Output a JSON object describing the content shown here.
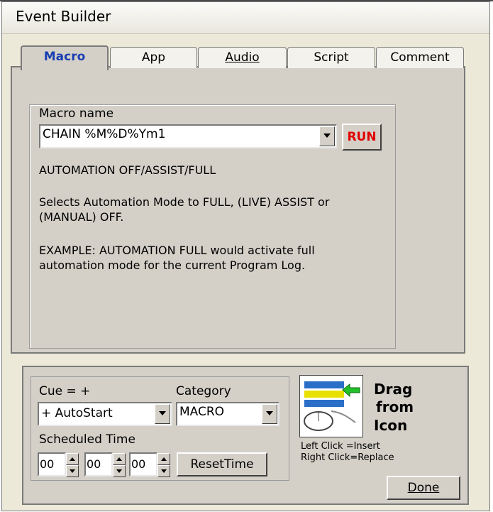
{
  "window": {
    "title": "Event Builder"
  },
  "tabs": [
    {
      "label": "Macro",
      "active": true
    },
    {
      "label": "App"
    },
    {
      "label": "Audio"
    },
    {
      "label": "Script"
    },
    {
      "label": "Comment"
    }
  ],
  "macro": {
    "name_label": "Macro name",
    "name_value": "CHAIN %M%D%Ym1",
    "run_label": "RUN",
    "heading": "AUTOMATION OFF/ASSIST/FULL",
    "desc1_line1": "Selects Automation Mode to FULL, (LIVE) ASSIST or",
    "desc1_line2": "(MANUAL) OFF.",
    "desc2_line1": "EXAMPLE: AUTOMATION FULL would activate full",
    "desc2_line2": "automation mode for the current Program Log."
  },
  "bottom": {
    "cue_label": "Cue = +",
    "cue_value": "+ AutoStart",
    "category_label": "Category",
    "category_value": "MACRO",
    "scheduled_label": "Scheduled Time",
    "time_hh": "00",
    "time_mm": "00",
    "time_ss": "00",
    "reset_label": "ResetTime",
    "drag_line1": "Drag",
    "drag_line2": "from",
    "drag_line3": "Icon",
    "left_click": "Left Click  =Insert",
    "right_click": "Right Click=Replace",
    "done_label": "Done"
  },
  "colors": {
    "run_text": "#e00000",
    "active_tab_text": "#1a3fb0"
  }
}
